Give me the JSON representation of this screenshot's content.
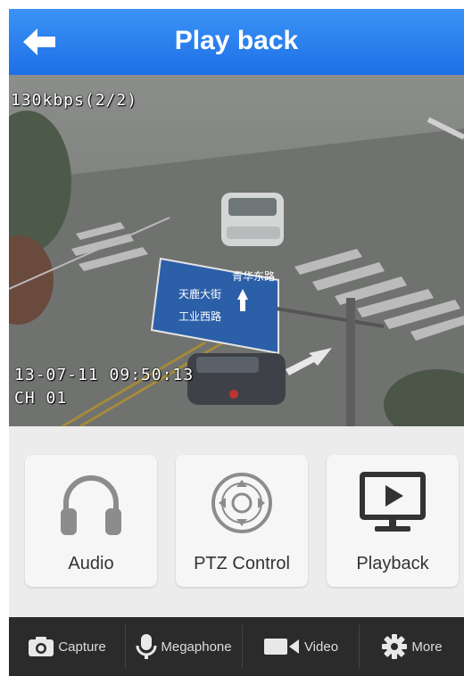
{
  "header": {
    "title": "Play back"
  },
  "video": {
    "bitrate_label": "130kbps(2/2)",
    "timestamp": "13-07-11 09:50:13",
    "channel": "CH 01"
  },
  "actions": [
    {
      "label": "Audio",
      "icon": "headphones-icon"
    },
    {
      "label": "PTZ Control",
      "icon": "ptz-dpad-icon"
    },
    {
      "label": "Playback",
      "icon": "playback-monitor-icon"
    }
  ],
  "toolbar": {
    "capture_label": "Capture",
    "megaphone_label": "Megaphone",
    "video_label": "Video",
    "more_label": "More"
  },
  "colors": {
    "header_blue": "#2a7ff0",
    "toolbar_bg": "#2b2b2b"
  }
}
